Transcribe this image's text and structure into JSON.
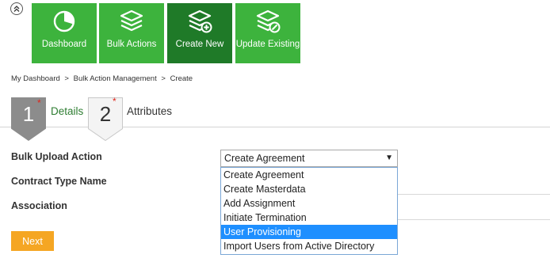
{
  "toolbar": {
    "items": [
      {
        "label": "Dashboard",
        "icon": "dashboard-pie-icon",
        "active": false
      },
      {
        "label": "Bulk Actions",
        "icon": "stacked-layers-icon",
        "active": false
      },
      {
        "label": "Create New",
        "icon": "layers-plus-icon",
        "active": true
      },
      {
        "label": "Update Existing",
        "icon": "layers-edit-icon",
        "active": false
      }
    ],
    "colors": {
      "tile": "#3db33d",
      "active_tile": "#1f7a28"
    }
  },
  "breadcrumb": {
    "items": [
      "My Dashboard",
      "Bulk Action Management",
      "Create"
    ],
    "separator": ">"
  },
  "steps": [
    {
      "number": "1",
      "label": "Details",
      "required_mark": "*",
      "active": true
    },
    {
      "number": "2",
      "label": "Attributes",
      "required_mark": "*",
      "active": false
    }
  ],
  "form": {
    "fields": [
      {
        "label": "Bulk Upload Action"
      },
      {
        "label": "Contract Type Name"
      },
      {
        "label": "Association"
      }
    ],
    "select": {
      "value": "Create Agreement",
      "options": [
        "Create Agreement",
        "Create Masterdata",
        "Add Assignment",
        "Initiate Termination",
        "User Provisioning",
        "Import Users from Active Directory"
      ],
      "highlighted_option": "User Provisioning",
      "arrow": "▼"
    },
    "next_label": "Next",
    "next_color": "#f5a623"
  }
}
